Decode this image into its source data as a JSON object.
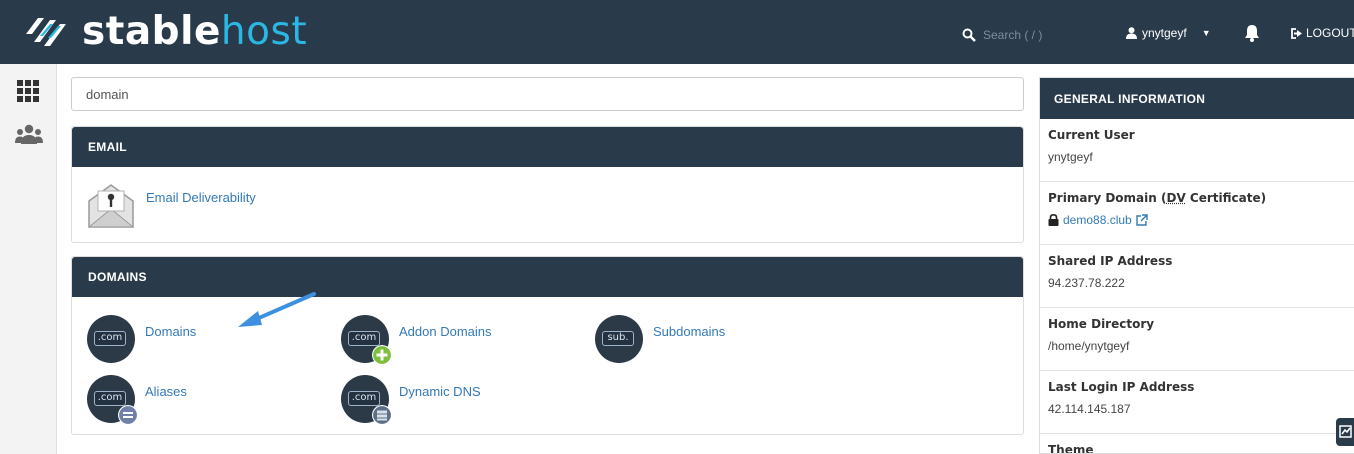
{
  "header": {
    "logo_part1": "stable",
    "logo_part2": "host",
    "search_placeholder": "Search ( / )",
    "username": "ynytgeyf",
    "logout_label": "LOGOUT"
  },
  "filter": {
    "value": "domain"
  },
  "email_section": {
    "title": "EMAIL",
    "items": [
      {
        "label": "Email Deliverability",
        "icon": "envelope-key-icon"
      }
    ]
  },
  "domains_section": {
    "title": "DOMAINS",
    "items": [
      {
        "label": "Domains",
        "icon_text": ".com"
      },
      {
        "label": "Addon Domains",
        "icon_text": ".com"
      },
      {
        "label": "Subdomains",
        "icon_text": "sub."
      },
      {
        "label": "Aliases",
        "icon_text": ".com"
      },
      {
        "label": "Dynamic DNS",
        "icon_text": ".com"
      }
    ]
  },
  "general_info": {
    "title": "GENERAL INFORMATION",
    "current_user_label": "Current User",
    "current_user_value": "ynytgeyf",
    "primary_domain_label_a": "Primary Domain (",
    "primary_domain_label_dv": "DV",
    "primary_domain_label_b": " Certificate)",
    "primary_domain_value": "demo88.club",
    "shared_ip_label": "Shared IP Address",
    "shared_ip_value": "94.237.78.222",
    "home_dir_label": "Home Directory",
    "home_dir_value": "/home/ynytgeyf",
    "last_login_label": "Last Login IP Address",
    "last_login_value": "42.114.145.187",
    "theme_label": "Theme"
  },
  "colors": {
    "header_bg": "#293a4a",
    "brand_accent": "#2bb7e4",
    "link": "#337ab7",
    "arrow": "#3d8fe0"
  }
}
